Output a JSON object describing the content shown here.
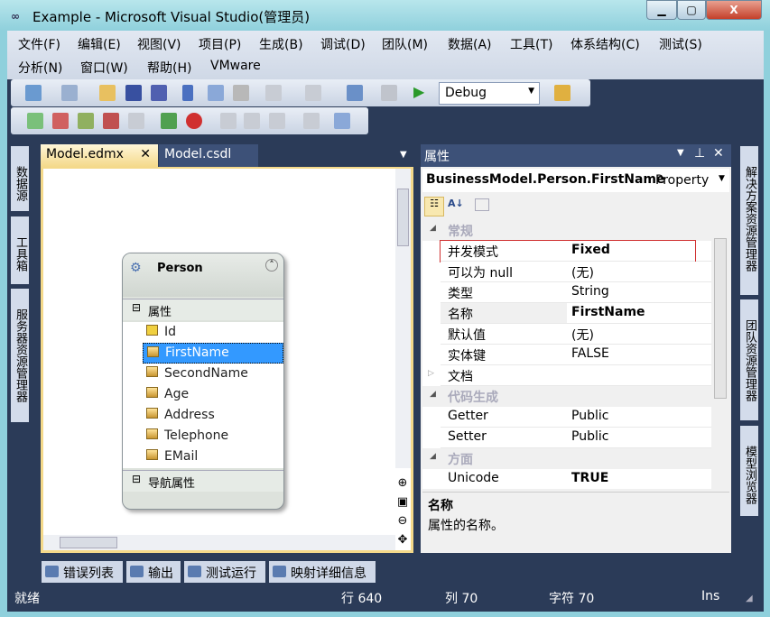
{
  "window": {
    "title": "Example - Microsoft Visual Studio(管理员)"
  },
  "menu": [
    "文件(F)",
    "编辑(E)",
    "视图(V)",
    "项目(P)",
    "生成(B)",
    "调试(D)",
    "团队(M)",
    "数据(A)",
    "工具(T)",
    "体系结构(C)",
    "测试(S)",
    "分析(N)",
    "窗口(W)",
    "帮助(H)",
    "VMware"
  ],
  "toolbar": {
    "config": "Debug"
  },
  "left_tabs": [
    "数据源",
    "工具箱",
    "服务器资源管理器"
  ],
  "right_tabs": [
    "解决方案资源管理器",
    "团队资源管理器",
    "模型浏览器"
  ],
  "doc_tabs": [
    "Model.edmx",
    "Model.csdl"
  ],
  "entity": {
    "name": "Person",
    "props_header": "属性",
    "props": [
      "Id",
      "FirstName",
      "SecondName",
      "Age",
      "Address",
      "Telephone",
      "EMail"
    ],
    "nav_header": "导航属性",
    "selected": "FirstName"
  },
  "properties": {
    "title": "属性",
    "object": "BusinessModel.Person.FirstName",
    "object_type": "Property",
    "cat1": "常规",
    "cat2": "代码生成",
    "cat3": "方面",
    "rows": [
      {
        "name": "并发模式",
        "value": "Fixed"
      },
      {
        "name": "可以为 null",
        "value": "(无)"
      },
      {
        "name": "类型",
        "value": "String"
      },
      {
        "name": "名称",
        "value": "FirstName"
      },
      {
        "name": "默认值",
        "value": "(无)"
      },
      {
        "name": "实体键",
        "value": "FALSE"
      },
      {
        "name": "文档",
        "value": ""
      },
      {
        "name": "Getter",
        "value": "Public"
      },
      {
        "name": "Setter",
        "value": "Public"
      },
      {
        "name": "Unicode",
        "value": "TRUE"
      }
    ],
    "desc_title": "名称",
    "desc_text": "属性的名称。"
  },
  "bottom_tabs": [
    "错误列表",
    "输出",
    "测试运行",
    "映射详细信息"
  ],
  "status": {
    "ready": "就绪",
    "line": "行 640",
    "col": "列 70",
    "char": "字符 70",
    "mode": "Ins"
  }
}
